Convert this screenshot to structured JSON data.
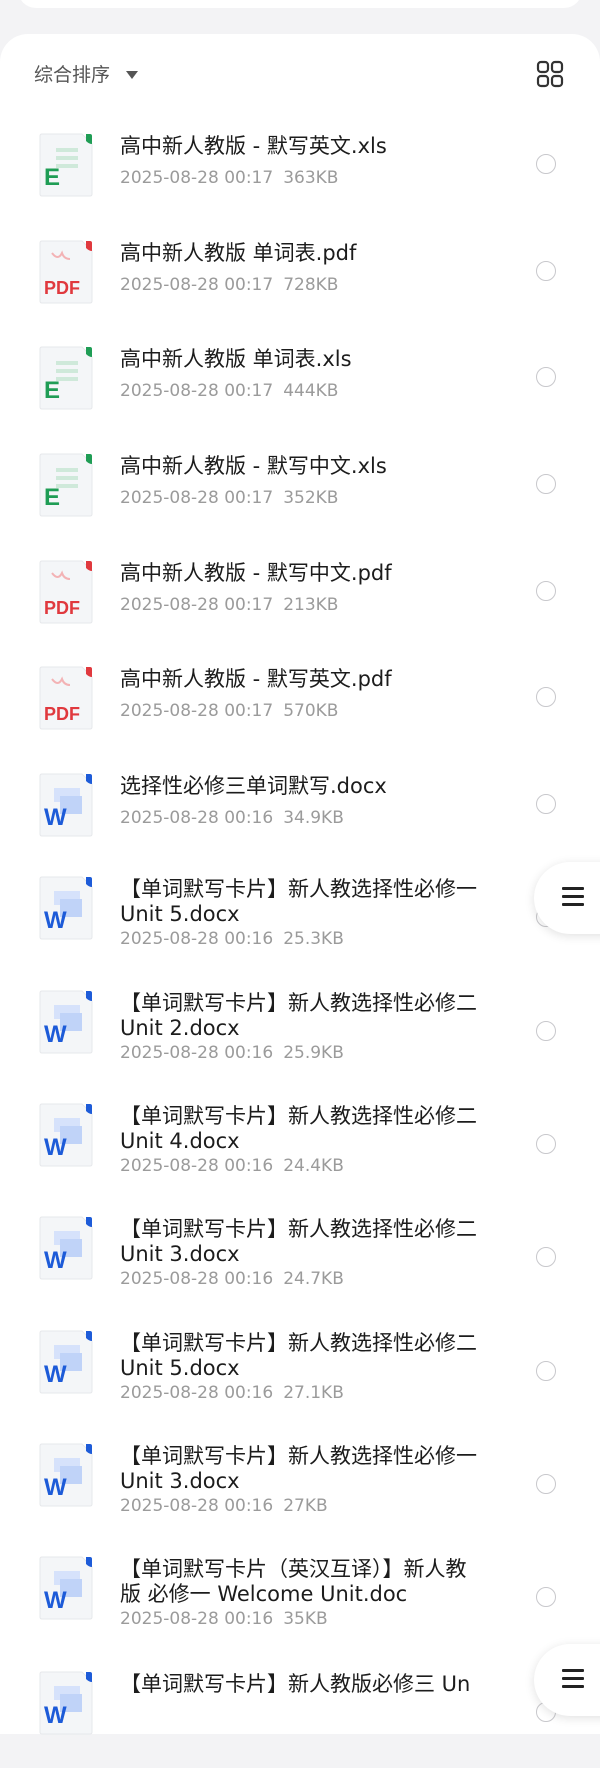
{
  "sort": {
    "label": "综合排序"
  },
  "files": [
    {
      "type": "xls",
      "icon": "excel-file-icon",
      "badge": "E",
      "title": "高中新人教版 - 默写英文.xls",
      "date": "2025-08-28 00:17",
      "size": "363KB"
    },
    {
      "type": "pdf",
      "icon": "pdf-file-icon",
      "badge": "PDF",
      "title": "高中新人教版 单词表.pdf",
      "date": "2025-08-28 00:17",
      "size": "728KB"
    },
    {
      "type": "xls",
      "icon": "excel-file-icon",
      "badge": "E",
      "title": "高中新人教版 单词表.xls",
      "date": "2025-08-28 00:17",
      "size": "444KB"
    },
    {
      "type": "xls",
      "icon": "excel-file-icon",
      "badge": "E",
      "title": "高中新人教版 - 默写中文.xls",
      "date": "2025-08-28 00:17",
      "size": "352KB"
    },
    {
      "type": "pdf",
      "icon": "pdf-file-icon",
      "badge": "PDF",
      "title": "高中新人教版 - 默写中文.pdf",
      "date": "2025-08-28 00:17",
      "size": "213KB"
    },
    {
      "type": "pdf",
      "icon": "pdf-file-icon",
      "badge": "PDF",
      "title": "高中新人教版 - 默写英文.pdf",
      "date": "2025-08-28 00:17",
      "size": "570KB"
    },
    {
      "type": "doc",
      "icon": "word-file-icon",
      "badge": "W",
      "title": "选择性必修三单词默写.docx",
      "date": "2025-08-28 00:16",
      "size": "34.9KB"
    },
    {
      "type": "doc",
      "icon": "word-file-icon",
      "badge": "W",
      "title": "【单词默写卡片】新人教选择性必修一 Unit 5.docx",
      "date": "2025-08-28 00:16",
      "size": "25.3KB"
    },
    {
      "type": "doc",
      "icon": "word-file-icon",
      "badge": "W",
      "title": "【单词默写卡片】新人教选择性必修二 Unit 2.docx",
      "date": "2025-08-28 00:16",
      "size": "25.9KB"
    },
    {
      "type": "doc",
      "icon": "word-file-icon",
      "badge": "W",
      "title": "【单词默写卡片】新人教选择性必修二 Unit 4.docx",
      "date": "2025-08-28 00:16",
      "size": "24.4KB"
    },
    {
      "type": "doc",
      "icon": "word-file-icon",
      "badge": "W",
      "title": "【单词默写卡片】新人教选择性必修二 Unit 3.docx",
      "date": "2025-08-28 00:16",
      "size": "24.7KB"
    },
    {
      "type": "doc",
      "icon": "word-file-icon",
      "badge": "W",
      "title": "【单词默写卡片】新人教选择性必修二 Unit 5.docx",
      "date": "2025-08-28 00:16",
      "size": "27.1KB"
    },
    {
      "type": "doc",
      "icon": "word-file-icon",
      "badge": "W",
      "title": "【单词默写卡片】新人教选择性必修一 Unit 3.docx",
      "date": "2025-08-28 00:16",
      "size": "27KB"
    },
    {
      "type": "doc",
      "icon": "word-file-icon",
      "badge": "W",
      "title": "【单词默写卡片（英汉互译）】新人教版 必修一 Welcome Unit.doc",
      "date": "2025-08-28 00:16",
      "size": "35KB"
    },
    {
      "type": "doc",
      "icon": "word-file-icon",
      "badge": "W",
      "title": "【单词默写卡片】新人教版必修三 Un",
      "date": "",
      "size": ""
    }
  ],
  "colors": {
    "excel": "#1f9d55",
    "pdf": "#e0393e",
    "word": "#1d5bd8"
  }
}
